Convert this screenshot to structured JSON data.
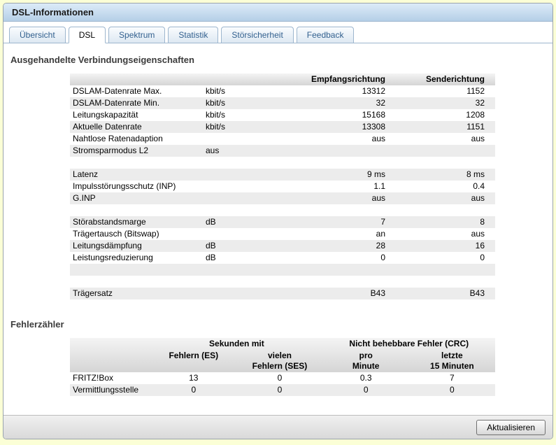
{
  "window": {
    "title": "DSL-Informationen"
  },
  "tabs": {
    "items": [
      {
        "label": "Übersicht"
      },
      {
        "label": "DSL"
      },
      {
        "label": "Spektrum"
      },
      {
        "label": "Statistik"
      },
      {
        "label": "Störsicherheit"
      },
      {
        "label": "Feedback"
      }
    ],
    "active_index": 1
  },
  "connection_section": {
    "heading": "Ausgehandelte Verbindungseigenschaften",
    "header": {
      "receive": "Empfangsrichtung",
      "send": "Senderichtung"
    },
    "rows": [
      {
        "label": "DSLAM-Datenrate Max.",
        "unit": "kbit/s",
        "rx": "13312",
        "tx": "1152"
      },
      {
        "label": "DSLAM-Datenrate Min.",
        "unit": "kbit/s",
        "rx": "32",
        "tx": "32"
      },
      {
        "label": "Leitungskapazität",
        "unit": "kbit/s",
        "rx": "15168",
        "tx": "1208"
      },
      {
        "label": "Aktuelle Datenrate",
        "unit": "kbit/s",
        "rx": "13308",
        "tx": "1151"
      },
      {
        "label": "Nahtlose Ratenadaption",
        "unit": "",
        "rx": "aus",
        "tx": "aus"
      },
      {
        "label": "Stromsparmodus L2",
        "unit": "aus",
        "rx": "",
        "tx": ""
      },
      {
        "label": "",
        "unit": "",
        "rx": "",
        "tx": ""
      },
      {
        "label": "Latenz",
        "unit": "",
        "rx": "9 ms",
        "tx": "8 ms"
      },
      {
        "label": "Impulsstörungsschutz (INP)",
        "unit": "",
        "rx": "1.1",
        "tx": "0.4"
      },
      {
        "label": "G.INP",
        "unit": "",
        "rx": "aus",
        "tx": "aus"
      },
      {
        "label": "",
        "unit": "",
        "rx": "",
        "tx": ""
      },
      {
        "label": "Störabstandsmarge",
        "unit": "dB",
        "rx": "7",
        "tx": "8"
      },
      {
        "label": "Trägertausch (Bitswap)",
        "unit": "",
        "rx": "an",
        "tx": "aus"
      },
      {
        "label": "Leitungsdämpfung",
        "unit": "dB",
        "rx": "28",
        "tx": "16"
      },
      {
        "label": "Leistungsreduzierung",
        "unit": "dB",
        "rx": "0",
        "tx": "0"
      },
      {
        "label": "",
        "unit": "",
        "rx": "",
        "tx": ""
      },
      {
        "label": "",
        "unit": "",
        "rx": "",
        "tx": ""
      },
      {
        "label": "Trägersatz",
        "unit": "",
        "rx": "B43",
        "tx": "B43"
      }
    ]
  },
  "error_section": {
    "heading": "Fehlerzähler",
    "group_headers": {
      "seconds": "Sekunden mit",
      "crc": "Nicht behebbare Fehler (CRC)"
    },
    "col_headers": {
      "es": "Fehlern (ES)",
      "ses_line1": "vielen",
      "ses_line2": "Fehlern (SES)",
      "per_min_line1": "pro",
      "per_min_line2": "Minute",
      "last15_line1": "letzte",
      "last15_line2": "15 Minuten"
    },
    "rows": [
      {
        "label": "FRITZ!Box",
        "es": "13",
        "ses": "0",
        "per_minute": "0.3",
        "last_15_min": "7"
      },
      {
        "label": "Vermittlungsstelle",
        "es": "0",
        "ses": "0",
        "per_minute": "0",
        "last_15_min": "0"
      }
    ]
  },
  "footer": {
    "refresh_button": "Aktualisieren"
  }
}
